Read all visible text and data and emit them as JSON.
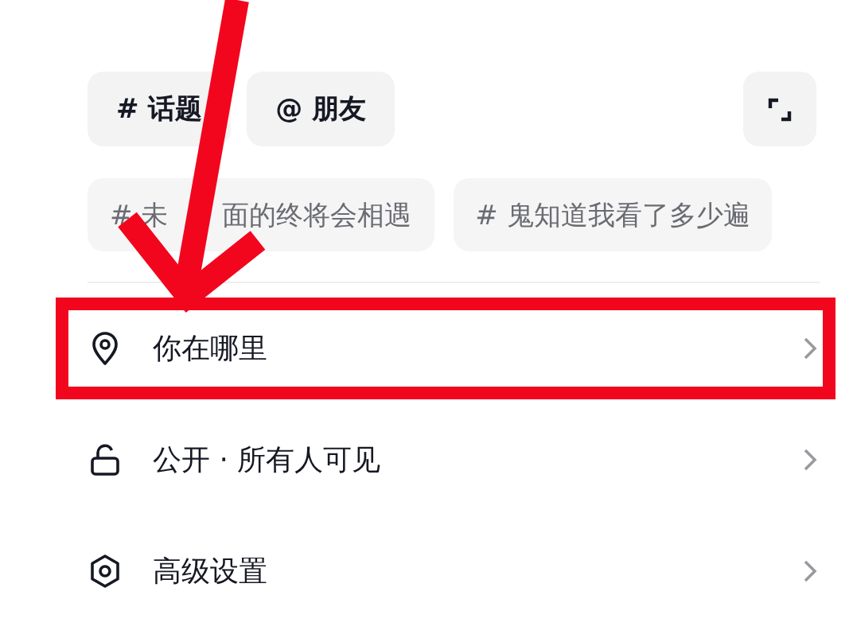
{
  "quick_chips": [
    {
      "label": "# 话题"
    },
    {
      "label": "@ 朋友"
    }
  ],
  "suggested_topics": [
    {
      "visible_parts": [
        "# 未",
        "面的终将会相遇"
      ]
    },
    {
      "visible_parts": [
        "# 鬼知道我看了多少遍"
      ]
    }
  ],
  "settings": [
    {
      "kind": "location",
      "label": "你在哪里",
      "highlighted": true
    },
    {
      "kind": "privacy",
      "label": "公开 · 所有人可见",
      "highlighted": false
    },
    {
      "kind": "advanced",
      "label": "高级设置",
      "highlighted": false
    }
  ],
  "annotation": {
    "arrow": true
  }
}
